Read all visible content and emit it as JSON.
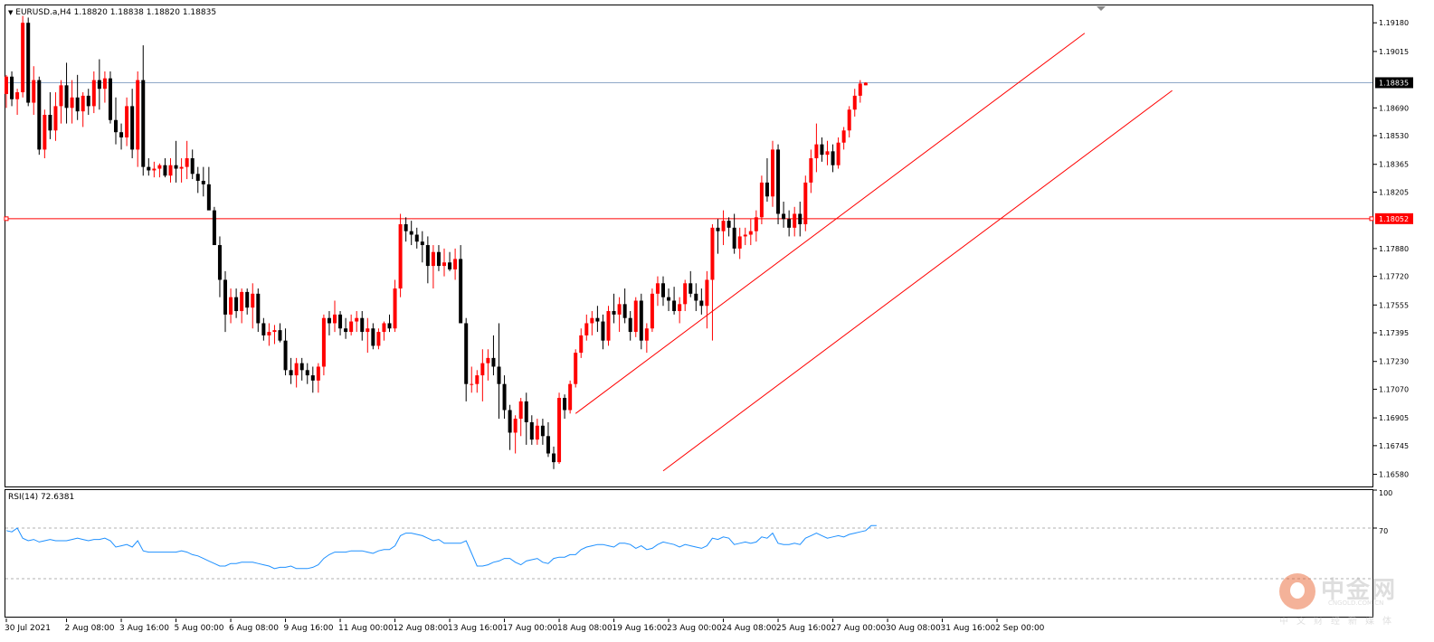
{
  "header": {
    "symbol_line": "EURUSD.a,H4  1.18820 1.18838 1.18820 1.18835",
    "rsi_line": "RSI(14) 72.6381"
  },
  "watermark": {
    "name_cn": "中金网",
    "site": "CNGOLD.COM.CN",
    "tagline": "中文财经新媒体"
  },
  "colors": {
    "bull": "#ff0000",
    "bear": "#000000",
    "price_line": "#8fa8c8",
    "level_line": "#ff0000",
    "channel": "#ff0000",
    "rsi": "#1e90ff"
  },
  "chart_data": [
    {
      "type": "candlestick",
      "title": "EURUSD.a,H4",
      "ylim": [
        1.1651,
        1.1928
      ],
      "y_ticks": [
        "1.19180",
        "1.19015",
        "1.18690",
        "1.18530",
        "1.18365",
        "1.18205",
        "1.17880",
        "1.17720",
        "1.17555",
        "1.17395",
        "1.17230",
        "1.17070",
        "1.16905",
        "1.16745",
        "1.16580"
      ],
      "x_tick_labels": [
        {
          "label": "30 Jul 2021",
          "index": 0
        },
        {
          "label": "2 Aug 08:00",
          "index": 11
        },
        {
          "label": "3 Aug 16:00",
          "index": 21
        },
        {
          "label": "5 Aug 00:00",
          "index": 31
        },
        {
          "label": "6 Aug 08:00",
          "index": 41
        },
        {
          "label": "9 Aug 16:00",
          "index": 51
        },
        {
          "label": "11 Aug 00:00",
          "index": 61
        },
        {
          "label": "12 Aug 08:00",
          "index": 71
        },
        {
          "label": "13 Aug 16:00",
          "index": 81
        },
        {
          "label": "17 Aug 00:00",
          "index": 91
        },
        {
          "label": "18 Aug 08:00",
          "index": 101
        },
        {
          "label": "19 Aug 16:00",
          "index": 111
        },
        {
          "label": "23 Aug 00:00",
          "index": 121
        },
        {
          "label": "24 Aug 08:00",
          "index": 131
        },
        {
          "label": "25 Aug 16:00",
          "index": 141
        },
        {
          "label": "27 Aug 00:00",
          "index": 151
        },
        {
          "label": "30 Aug 08:00",
          "index": 161
        },
        {
          "label": "31 Aug 16:00",
          "index": 171
        },
        {
          "label": "2 Sep 00:00",
          "index": 181
        }
      ],
      "current_price": {
        "value": 1.18835,
        "label": "1.18835"
      },
      "horizontal_level": {
        "value": 1.18052,
        "label": "1.18052"
      },
      "channel_lines": [
        {
          "from": {
            "index": 104,
            "price": 1.1693
          },
          "to": {
            "index": 197,
            "price": 1.1912
          }
        },
        {
          "from": {
            "index": 120,
            "price": 1.166
          },
          "to": {
            "index": 213,
            "price": 1.1879
          }
        }
      ],
      "candles_ohlc": [
        [
          1.1877,
          1.1888,
          1.1869,
          1.1887
        ],
        [
          1.1887,
          1.189,
          1.187,
          1.1874
        ],
        [
          1.1874,
          1.188,
          1.1865,
          1.1878
        ],
        [
          1.1878,
          1.1922,
          1.1875,
          1.1918
        ],
        [
          1.1918,
          1.1921,
          1.187,
          1.1872
        ],
        [
          1.1872,
          1.1893,
          1.1865,
          1.1885
        ],
        [
          1.1885,
          1.1887,
          1.1842,
          1.1845
        ],
        [
          1.1845,
          1.1868,
          1.184,
          1.1865
        ],
        [
          1.1865,
          1.1878,
          1.1851,
          1.1856
        ],
        [
          1.1856,
          1.1878,
          1.185,
          1.187
        ],
        [
          1.187,
          1.1885,
          1.186,
          1.1882
        ],
        [
          1.1882,
          1.1895,
          1.186,
          1.1869
        ],
        [
          1.1869,
          1.1885,
          1.186,
          1.1875
        ],
        [
          1.1875,
          1.1888,
          1.1862,
          1.1867
        ],
        [
          1.1867,
          1.1878,
          1.1858,
          1.1876
        ],
        [
          1.1876,
          1.188,
          1.1865,
          1.187
        ],
        [
          1.187,
          1.189,
          1.1866,
          1.1885
        ],
        [
          1.1885,
          1.1897,
          1.1868,
          1.188
        ],
        [
          1.188,
          1.189,
          1.1872,
          1.1886
        ],
        [
          1.1886,
          1.189,
          1.186,
          1.1862
        ],
        [
          1.1862,
          1.1875,
          1.1848,
          1.1855
        ],
        [
          1.1855,
          1.186,
          1.1845,
          1.1852
        ],
        [
          1.1852,
          1.1875,
          1.1847,
          1.187
        ],
        [
          1.187,
          1.188,
          1.184,
          1.1845
        ],
        [
          1.1845,
          1.189,
          1.1835,
          1.1885
        ],
        [
          1.1885,
          1.1905,
          1.183,
          1.1835
        ],
        [
          1.1835,
          1.184,
          1.183,
          1.1833
        ],
        [
          1.1833,
          1.1838,
          1.1829,
          1.1834
        ],
        [
          1.1834,
          1.1837,
          1.1829,
          1.1836
        ],
        [
          1.1836,
          1.184,
          1.1829,
          1.183
        ],
        [
          1.183,
          1.184,
          1.1826,
          1.1836
        ],
        [
          1.1836,
          1.185,
          1.1826,
          1.1834
        ],
        [
          1.1834,
          1.184,
          1.1826,
          1.1835
        ],
        [
          1.1835,
          1.185,
          1.1828,
          1.184
        ],
        [
          1.184,
          1.1845,
          1.1828,
          1.1831
        ],
        [
          1.1831,
          1.1835,
          1.182,
          1.1827
        ],
        [
          1.1827,
          1.1835,
          1.1818,
          1.1825
        ],
        [
          1.1825,
          1.1835,
          1.1812,
          1.181
        ],
        [
          1.181,
          1.1812,
          1.1795,
          1.179
        ],
        [
          1.179,
          1.1795,
          1.176,
          1.177
        ],
        [
          1.177,
          1.1775,
          1.174,
          1.175
        ],
        [
          1.175,
          1.1765,
          1.1745,
          1.176
        ],
        [
          1.176,
          1.1765,
          1.1748,
          1.1752
        ],
        [
          1.1752,
          1.1765,
          1.1745,
          1.1763
        ],
        [
          1.1763,
          1.1765,
          1.175,
          1.1754
        ],
        [
          1.1754,
          1.1768,
          1.1742,
          1.1762
        ],
        [
          1.1762,
          1.1765,
          1.174,
          1.1745
        ],
        [
          1.1745,
          1.1748,
          1.1735,
          1.1738
        ],
        [
          1.1738,
          1.1745,
          1.1732,
          1.174
        ],
        [
          1.174,
          1.1744,
          1.1733,
          1.1741
        ],
        [
          1.1741,
          1.1745,
          1.1734,
          1.1735
        ],
        [
          1.1735,
          1.1742,
          1.1715,
          1.1718
        ],
        [
          1.1718,
          1.1725,
          1.171,
          1.1715
        ],
        [
          1.1715,
          1.1725,
          1.1708,
          1.1722
        ],
        [
          1.1722,
          1.1725,
          1.1712,
          1.1718
        ],
        [
          1.1718,
          1.1722,
          1.171,
          1.1715
        ],
        [
          1.1715,
          1.172,
          1.1705,
          1.1712
        ],
        [
          1.1712,
          1.1722,
          1.1705,
          1.172
        ],
        [
          1.172,
          1.175,
          1.1715,
          1.1748
        ],
        [
          1.1748,
          1.1752,
          1.1738,
          1.1745
        ],
        [
          1.1745,
          1.1758,
          1.174,
          1.175
        ],
        [
          1.175,
          1.1752,
          1.1738,
          1.1742
        ],
        [
          1.1742,
          1.1748,
          1.1736,
          1.174
        ],
        [
          1.174,
          1.175,
          1.1738,
          1.1746
        ],
        [
          1.1746,
          1.1752,
          1.174,
          1.1748
        ],
        [
          1.1748,
          1.1752,
          1.1735,
          1.174
        ],
        [
          1.174,
          1.1748,
          1.1728,
          1.1742
        ],
        [
          1.1742,
          1.1745,
          1.173,
          1.1732
        ],
        [
          1.1732,
          1.1742,
          1.173,
          1.174
        ],
        [
          1.174,
          1.1746,
          1.1735,
          1.1745
        ],
        [
          1.1745,
          1.175,
          1.174,
          1.1742
        ],
        [
          1.1742,
          1.177,
          1.174,
          1.1765
        ],
        [
          1.1765,
          1.1808,
          1.176,
          1.1802
        ],
        [
          1.1802,
          1.1806,
          1.1792,
          1.1798
        ],
        [
          1.1798,
          1.1804,
          1.179,
          1.1796
        ],
        [
          1.1796,
          1.18,
          1.1788,
          1.1792
        ],
        [
          1.1792,
          1.1798,
          1.178,
          1.179
        ],
        [
          1.179,
          1.1795,
          1.1768,
          1.1778
        ],
        [
          1.1778,
          1.179,
          1.1765,
          1.1786
        ],
        [
          1.1786,
          1.179,
          1.1775,
          1.1778
        ],
        [
          1.1778,
          1.1788,
          1.1772,
          1.178
        ],
        [
          1.178,
          1.1786,
          1.1775,
          1.1776
        ],
        [
          1.1776,
          1.1788,
          1.177,
          1.1782
        ],
        [
          1.1782,
          1.179,
          1.1755,
          1.1745
        ],
        [
          1.1745,
          1.1748,
          1.17,
          1.171
        ],
        [
          1.171,
          1.172,
          1.1705,
          1.171
        ],
        [
          1.171,
          1.1718,
          1.1705,
          1.1715
        ],
        [
          1.1715,
          1.173,
          1.17,
          1.1722
        ],
        [
          1.1722,
          1.173,
          1.1712,
          1.1725
        ],
        [
          1.1725,
          1.1738,
          1.1715,
          1.172
        ],
        [
          1.172,
          1.1745,
          1.169,
          1.171
        ],
        [
          1.171,
          1.1715,
          1.169,
          1.1695
        ],
        [
          1.1695,
          1.1698,
          1.1672,
          1.1682
        ],
        [
          1.1682,
          1.1692,
          1.167,
          1.169
        ],
        [
          1.169,
          1.1702,
          1.168,
          1.17
        ],
        [
          1.17,
          1.1705,
          1.1675,
          1.1688
        ],
        [
          1.1688,
          1.1692,
          1.1675,
          1.1678
        ],
        [
          1.1678,
          1.169,
          1.1675,
          1.1686
        ],
        [
          1.1686,
          1.169,
          1.1675,
          1.168
        ],
        [
          1.168,
          1.1688,
          1.1668,
          1.167
        ],
        [
          1.167,
          1.1674,
          1.1661,
          1.1665
        ],
        [
          1.1665,
          1.1705,
          1.1664,
          1.1702
        ],
        [
          1.1702,
          1.1704,
          1.169,
          1.1695
        ],
        [
          1.1695,
          1.1712,
          1.1693,
          1.171
        ],
        [
          1.171,
          1.173,
          1.1708,
          1.1728
        ],
        [
          1.1728,
          1.1742,
          1.1725,
          1.1738
        ],
        [
          1.1738,
          1.175,
          1.1735,
          1.1745
        ],
        [
          1.1745,
          1.1752,
          1.1738,
          1.1748
        ],
        [
          1.1748,
          1.1755,
          1.174,
          1.1746
        ],
        [
          1.1746,
          1.175,
          1.173,
          1.1735
        ],
        [
          1.1735,
          1.1755,
          1.1732,
          1.1752
        ],
        [
          1.1752,
          1.1762,
          1.1745,
          1.175
        ],
        [
          1.175,
          1.176,
          1.174,
          1.1756
        ],
        [
          1.1756,
          1.1765,
          1.1745,
          1.1748
        ],
        [
          1.1748,
          1.1752,
          1.1735,
          1.174
        ],
        [
          1.174,
          1.176,
          1.1737,
          1.1758
        ],
        [
          1.1758,
          1.1762,
          1.173,
          1.1735
        ],
        [
          1.1735,
          1.1745,
          1.1728,
          1.1742
        ],
        [
          1.1742,
          1.1765,
          1.174,
          1.1762
        ],
        [
          1.1762,
          1.1772,
          1.1755,
          1.1768
        ],
        [
          1.1768,
          1.1772,
          1.1755,
          1.176
        ],
        [
          1.176,
          1.1765,
          1.1752,
          1.1758
        ],
        [
          1.1758,
          1.1766,
          1.175,
          1.1752
        ],
        [
          1.1752,
          1.176,
          1.1745,
          1.1756
        ],
        [
          1.1756,
          1.177,
          1.1752,
          1.1768
        ],
        [
          1.1768,
          1.1775,
          1.176,
          1.1762
        ],
        [
          1.1762,
          1.1768,
          1.1752,
          1.1758
        ],
        [
          1.1758,
          1.1765,
          1.175,
          1.1755
        ],
        [
          1.1755,
          1.1775,
          1.1742,
          1.177
        ],
        [
          1.177,
          1.1802,
          1.1735,
          1.18
        ],
        [
          1.18,
          1.1805,
          1.1785,
          1.1798
        ],
        [
          1.1798,
          1.181,
          1.179,
          1.1804
        ],
        [
          1.1804,
          1.1806,
          1.1795,
          1.18
        ],
        [
          1.18,
          1.1808,
          1.1785,
          1.1788
        ],
        [
          1.1788,
          1.18,
          1.1782,
          1.1795
        ],
        [
          1.1795,
          1.18,
          1.179,
          1.1796
        ],
        [
          1.1796,
          1.1805,
          1.179,
          1.1798
        ],
        [
          1.1798,
          1.181,
          1.1792,
          1.1806
        ],
        [
          1.1806,
          1.183,
          1.1802,
          1.1826
        ],
        [
          1.1826,
          1.184,
          1.1815,
          1.1818
        ],
        [
          1.1818,
          1.185,
          1.1812,
          1.1845
        ],
        [
          1.1845,
          1.1848,
          1.1802,
          1.1808
        ],
        [
          1.1808,
          1.1815,
          1.18,
          1.1805
        ],
        [
          1.1805,
          1.181,
          1.1795,
          1.18
        ],
        [
          1.18,
          1.1812,
          1.1795,
          1.1808
        ],
        [
          1.1808,
          1.1815,
          1.1795,
          1.1802
        ],
        [
          1.1802,
          1.183,
          1.1798,
          1.1826
        ],
        [
          1.1826,
          1.1845,
          1.182,
          1.184
        ],
        [
          1.184,
          1.186,
          1.1832,
          1.1848
        ],
        [
          1.1848,
          1.1852,
          1.1838,
          1.1842
        ],
        [
          1.1842,
          1.185,
          1.1836,
          1.1844
        ],
        [
          1.1844,
          1.1848,
          1.1832,
          1.1836
        ],
        [
          1.1836,
          1.1852,
          1.1834,
          1.1849
        ],
        [
          1.1849,
          1.1858,
          1.1845,
          1.1856
        ],
        [
          1.1856,
          1.187,
          1.1852,
          1.1868
        ],
        [
          1.1868,
          1.188,
          1.1864,
          1.1876
        ],
        [
          1.1876,
          1.1885,
          1.1872,
          1.1883
        ],
        [
          1.1882,
          1.18838,
          1.1882,
          1.18835
        ]
      ]
    },
    {
      "type": "line",
      "title": "RSI(14) 72.6381",
      "ylim": [
        0,
        100
      ],
      "y_ticks": [
        "100",
        "70"
      ],
      "levels": [
        70,
        30
      ],
      "values": [
        68,
        67,
        70,
        62,
        60,
        61,
        59,
        60,
        61,
        60,
        60,
        60,
        61,
        62,
        61,
        60,
        61,
        61,
        62,
        60,
        55,
        56,
        57,
        55,
        60,
        52,
        51,
        51,
        51,
        51,
        51,
        51,
        52,
        51,
        49,
        48,
        46,
        44,
        42,
        40,
        40,
        42,
        42,
        43,
        43,
        43,
        42,
        41,
        40,
        38,
        39,
        39,
        40,
        38,
        38,
        38,
        39,
        41,
        46,
        49,
        51,
        51,
        51,
        52,
        52,
        52,
        51,
        50,
        52,
        53,
        53,
        56,
        64,
        66,
        66,
        65,
        64,
        62,
        60,
        61,
        58,
        58,
        58,
        58,
        60,
        50,
        40,
        40,
        41,
        43,
        44,
        46,
        46,
        43,
        41,
        44,
        45,
        46,
        43,
        42,
        46,
        47,
        47,
        49,
        49,
        53,
        55,
        56,
        57,
        57,
        56,
        55,
        58,
        58,
        57,
        54,
        56,
        53,
        54,
        57,
        59,
        58,
        57,
        55,
        57,
        56,
        55,
        54,
        56,
        62,
        61,
        63,
        62,
        57,
        58,
        59,
        58,
        59,
        63,
        62,
        66,
        58,
        57,
        57,
        58,
        57,
        62,
        64,
        66,
        64,
        62,
        63,
        64,
        63,
        65,
        66,
        67,
        68,
        72,
        72
      ]
    }
  ]
}
